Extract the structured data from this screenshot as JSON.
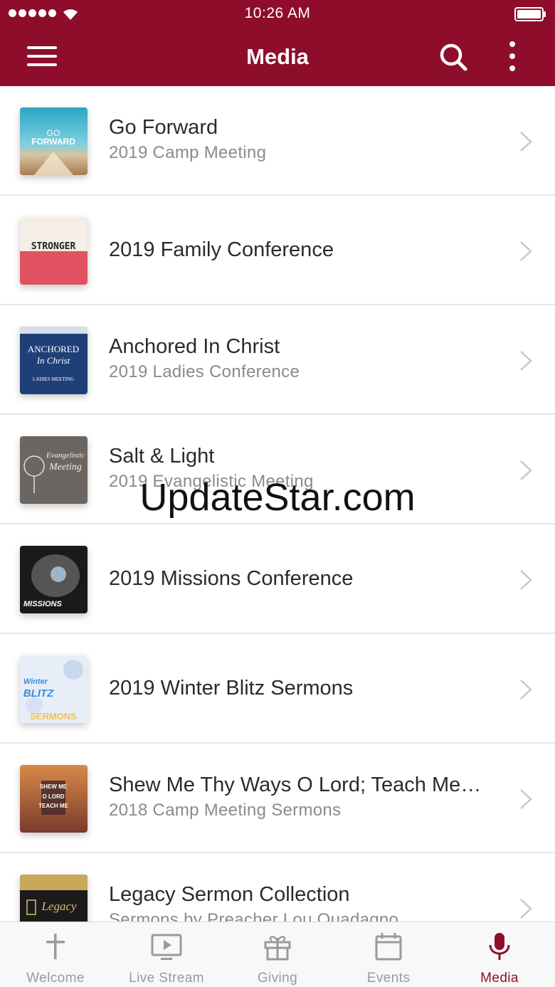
{
  "status_bar": {
    "time": "10:26 AM"
  },
  "header": {
    "title": "Media"
  },
  "icons": {
    "menu": "hamburger-icon",
    "search": "search-icon",
    "more": "more-vertical-icon",
    "chevron": "chevron-right-icon"
  },
  "media_items": [
    {
      "title": "Go Forward",
      "subtitle": "2019 Camp Meeting",
      "art_text": [
        "GO",
        "FORWARD"
      ]
    },
    {
      "title": "2019 Family Conference",
      "subtitle": "",
      "art_text": [
        "STRONGER"
      ]
    },
    {
      "title": "Anchored In Christ",
      "subtitle": "2019 Ladies Conference",
      "art_text": [
        "ANCHORED",
        "In Christ",
        "LADIES MEETING"
      ]
    },
    {
      "title": "Salt & Light",
      "subtitle": "2019 Evangelistic Meeting",
      "art_text": [
        "Evangelistic",
        "Meeting"
      ]
    },
    {
      "title": "2019 Missions Conference",
      "subtitle": "",
      "art_text": [
        "MISSIONS"
      ]
    },
    {
      "title": "2019 Winter Blitz Sermons",
      "subtitle": "",
      "art_text": [
        "Winter",
        "BLITZ",
        "SERMONS"
      ]
    },
    {
      "title": "Shew Me Thy Ways O Lord; Teach Me…",
      "subtitle": "2018 Camp Meeting Sermons",
      "art_text": [
        "SHEW ME",
        "O LORD",
        "TEACH ME"
      ]
    },
    {
      "title": "Legacy Sermon Collection",
      "subtitle": "Sermons by Preacher Lou Quadagno",
      "art_text": [
        "Legacy"
      ]
    }
  ],
  "watermark": "UpdateStar.com",
  "tabs": [
    {
      "label": "Welcome",
      "icon": "cross-icon",
      "active": false
    },
    {
      "label": "Live Stream",
      "icon": "tv-play-icon",
      "active": false
    },
    {
      "label": "Giving",
      "icon": "gift-icon",
      "active": false
    },
    {
      "label": "Events",
      "icon": "calendar-icon",
      "active": false
    },
    {
      "label": "Media",
      "icon": "microphone-icon",
      "active": true
    }
  ],
  "colors": {
    "brand": "#8e0d2b",
    "tab_inactive": "#9a9a9a",
    "divider": "#e6e6e6"
  }
}
